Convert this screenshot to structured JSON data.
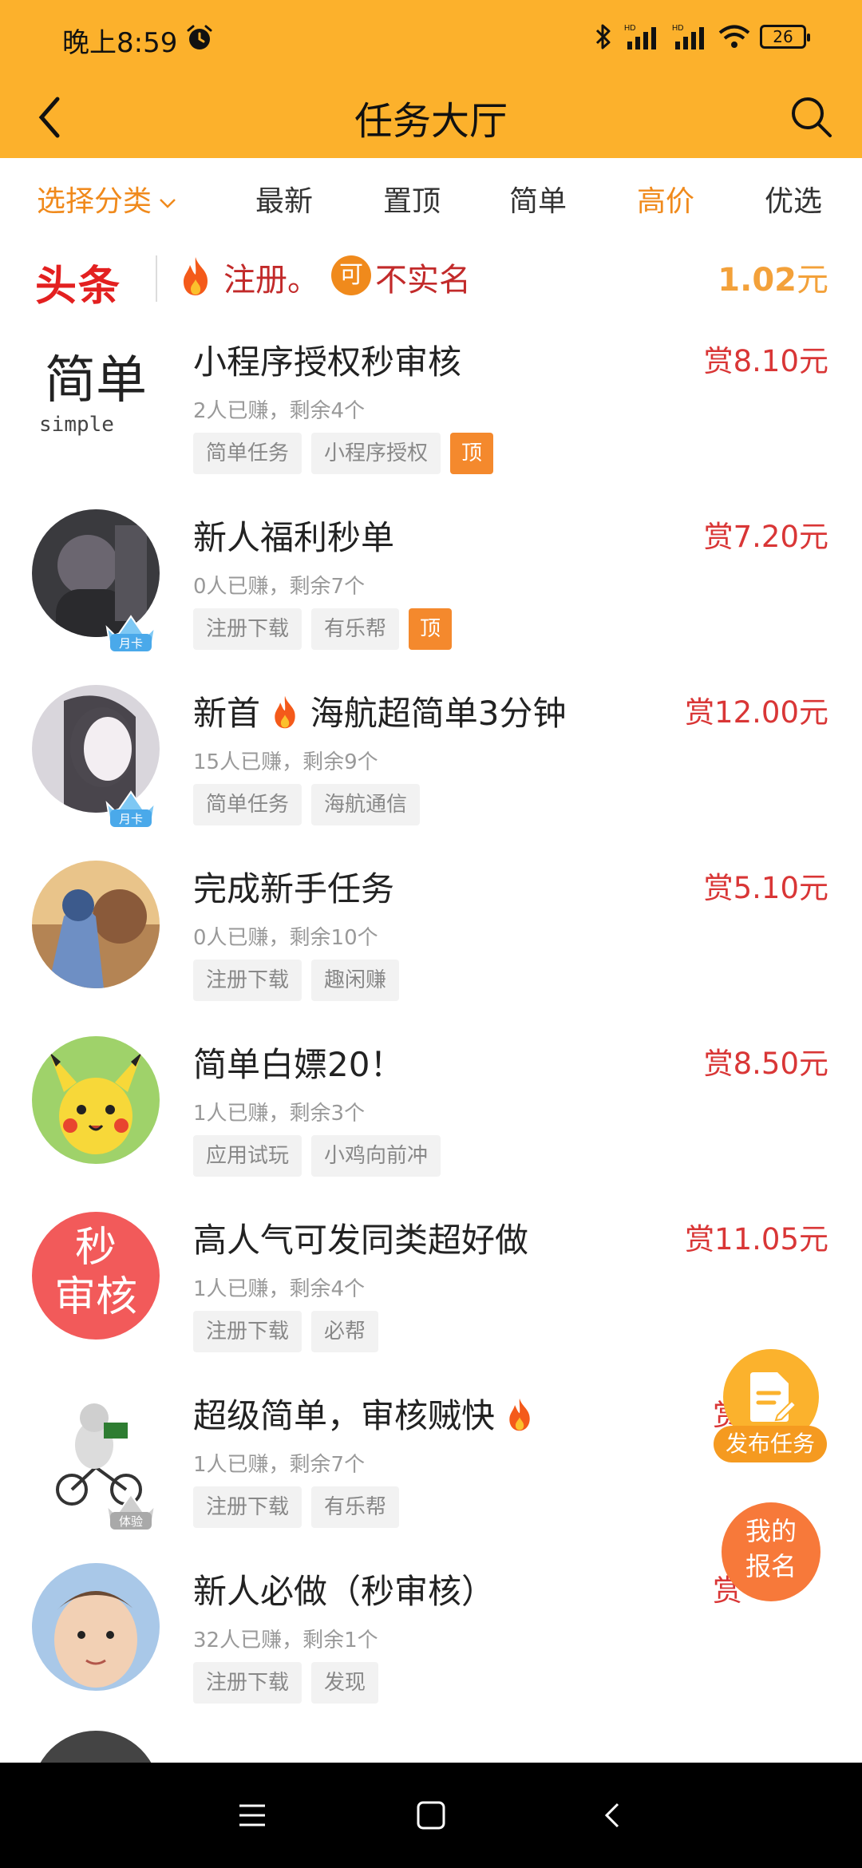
{
  "status_bar": {
    "time": "晚上8:59",
    "battery": "26"
  },
  "header": {
    "title": "任务大厅"
  },
  "tabs": [
    {
      "label": "选择分类",
      "active": true
    },
    {
      "label": "最新",
      "active": false
    },
    {
      "label": "置顶",
      "active": false
    },
    {
      "label": "简单",
      "active": false
    },
    {
      "label": "高价",
      "active": true
    },
    {
      "label": "优选",
      "active": false
    }
  ],
  "headline": {
    "logo": "头条",
    "text1": "注册。",
    "badge": "可",
    "text2": "不实名",
    "amount": "1.02",
    "unit": "元"
  },
  "tasks": [
    {
      "title": "小程序授权秒审核",
      "reward": "赏8.10元",
      "meta": "2人已赚，剩余4个",
      "tags": [
        "简单任务",
        "小程序授权"
      ],
      "top": "顶"
    },
    {
      "title": "新人福利秒单",
      "reward": "赏7.20元",
      "meta": "0人已赚，剩余7个",
      "tags": [
        "注册下载",
        "有乐帮"
      ],
      "top": "顶",
      "crown": "月卡"
    },
    {
      "title": "新首",
      "title_rest": "海航超简单3分钟",
      "reward": "赏12.00元",
      "meta": "15人已赚，剩余9个",
      "tags": [
        "简单任务",
        "海航通信"
      ],
      "crown": "月卡"
    },
    {
      "title": "完成新手任务",
      "reward": "赏5.10元",
      "meta": "0人已赚，剩余10个",
      "tags": [
        "注册下载",
        "趣闲赚"
      ]
    },
    {
      "title": "简单白嫖20！",
      "reward": "赏8.50元",
      "meta": "1人已赚，剩余3个",
      "tags": [
        "应用试玩",
        "小鸡向前冲"
      ]
    },
    {
      "title": "高人气可发同类超好做",
      "reward": "赏11.05元",
      "meta": "1人已赚，剩余4个",
      "tags": [
        "注册下载",
        "必帮"
      ],
      "avatar_text": [
        "秒",
        "审核"
      ]
    },
    {
      "title": "超级简单，审核贼快",
      "reward": "赏",
      "meta": "1人已赚，剩余7个",
      "tags": [
        "注册下载",
        "有乐帮"
      ],
      "crown": "体验"
    },
    {
      "title": "新人必做（秒审核）",
      "reward": "赏",
      "meta": "32人已赚，剩余1个",
      "tags": [
        "注册下载",
        "发现"
      ]
    }
  ],
  "fab": {
    "publish": "发布任务",
    "mine_line1": "我的",
    "mine_line2": "报名"
  },
  "avatar_simple": {
    "big": "简单",
    "small": "simple"
  }
}
